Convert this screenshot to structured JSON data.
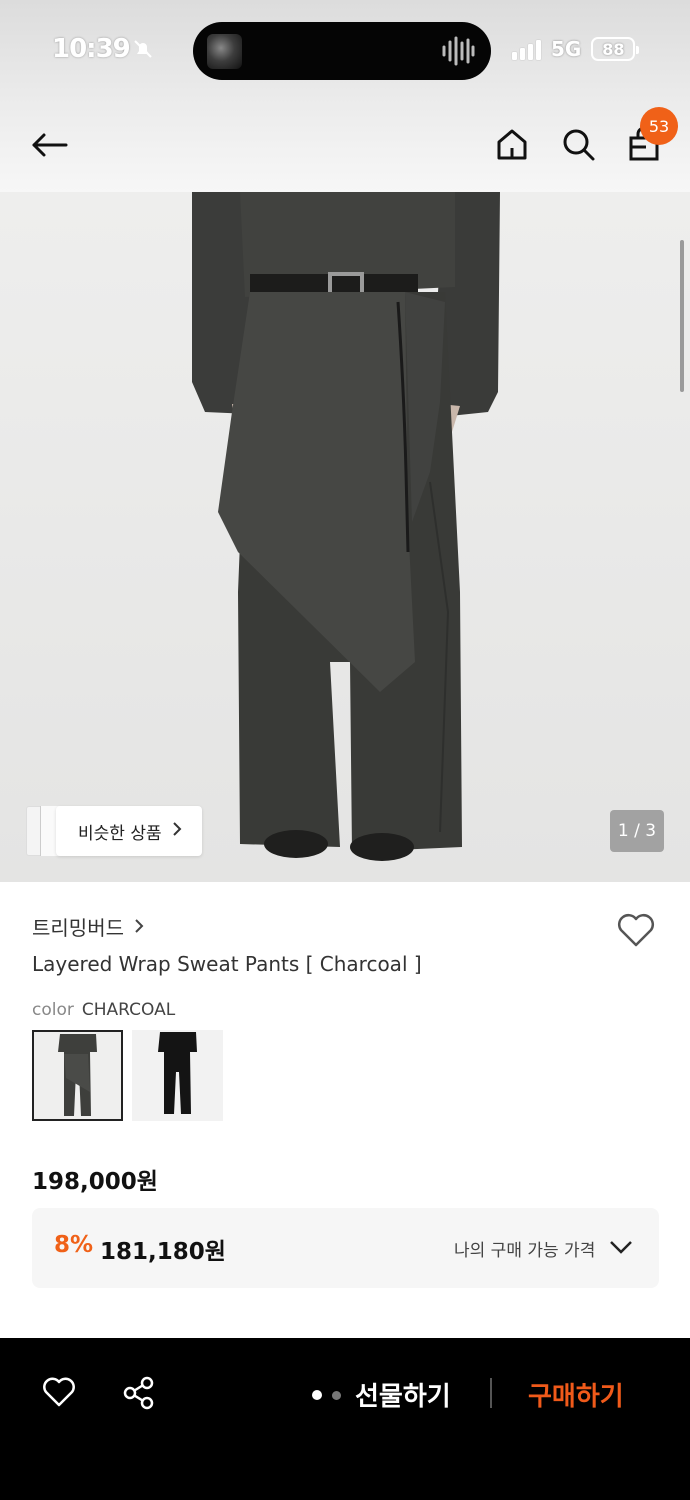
{
  "status_bar": {
    "time": "10:39",
    "network": "5G",
    "battery": "88"
  },
  "header": {
    "cart_count": "53",
    "icons": [
      "back-arrow-icon",
      "home-icon",
      "search-icon",
      "shopping-bag-icon"
    ]
  },
  "gallery": {
    "similar_label": "비슷한 상품",
    "page_indicator": "1 / 3"
  },
  "product": {
    "brand": "트리밍버드",
    "title": "Layered Wrap Sweat Pants [ Charcoal ]",
    "color_label": "color",
    "color_value": "CHARCOAL",
    "price": "198,000원",
    "discount_rate": "8%",
    "discount_price": "181,180원",
    "my_price_label": "나의 구매 가능 가격"
  },
  "bottom_bar": {
    "gift_label": "선물하기",
    "buy_label": "구매하기"
  },
  "colors": {
    "accent": "#f06118",
    "buy": "#f05a1a",
    "bottom_bg": "#000000"
  }
}
